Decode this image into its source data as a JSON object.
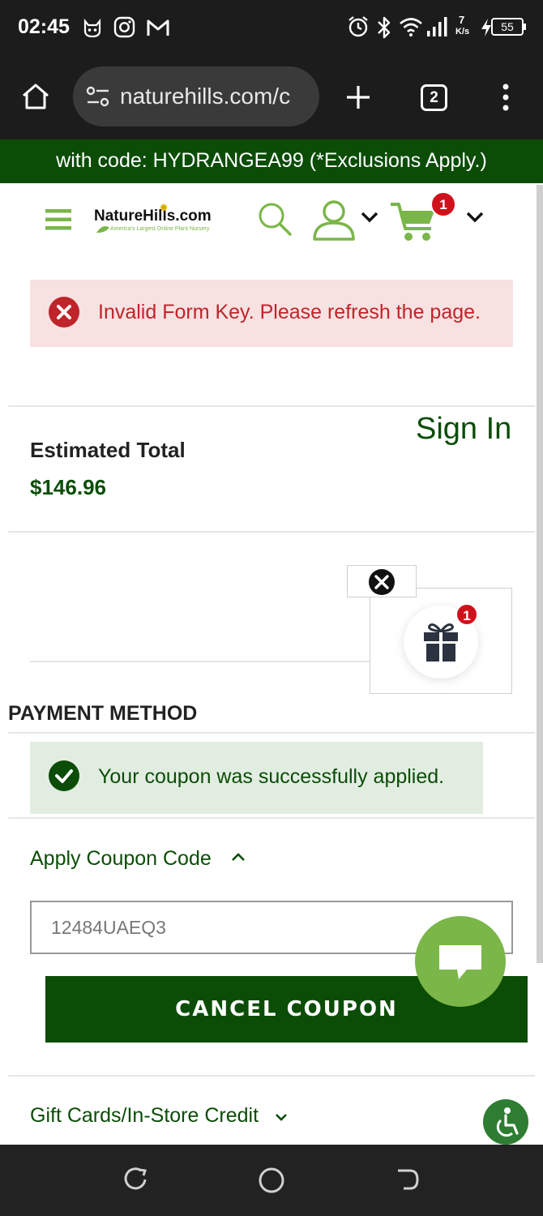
{
  "status_bar": {
    "time": "02:45",
    "net_speed_value": "7",
    "net_speed_unit": "K/s",
    "battery": "55"
  },
  "browser": {
    "url": "naturehills.com/c",
    "tab_count": "2"
  },
  "promo_banner": {
    "text": "with code: HYDRANGEA99 (*Exclusions Apply.)"
  },
  "header": {
    "logo_name": "NatureHills.com",
    "logo_tagline": "America's Largest Online Plant Nursery",
    "cart_count": "1"
  },
  "error_message": {
    "text": "Invalid Form Key. Please refresh the page."
  },
  "sign_in": {
    "label": "Sign In"
  },
  "estimated_total": {
    "label": "Estimated Total",
    "value": "$146.96"
  },
  "gift_popup": {
    "badge_count": "1"
  },
  "payment": {
    "title": "PAYMENT METHOD",
    "success_text": "Your coupon was successfully applied.",
    "coupon_toggle_label": "Apply Coupon Code",
    "coupon_value": "12484UAEQ3",
    "cancel_button_label": "CANCEL COUPON",
    "gift_cards_label": "Gift Cards/In-Store Credit"
  },
  "colors": {
    "brand_green": "#0b4d07",
    "accent_green": "#7ab648",
    "error_red": "#c0242b",
    "badge_red": "#d0111b"
  }
}
